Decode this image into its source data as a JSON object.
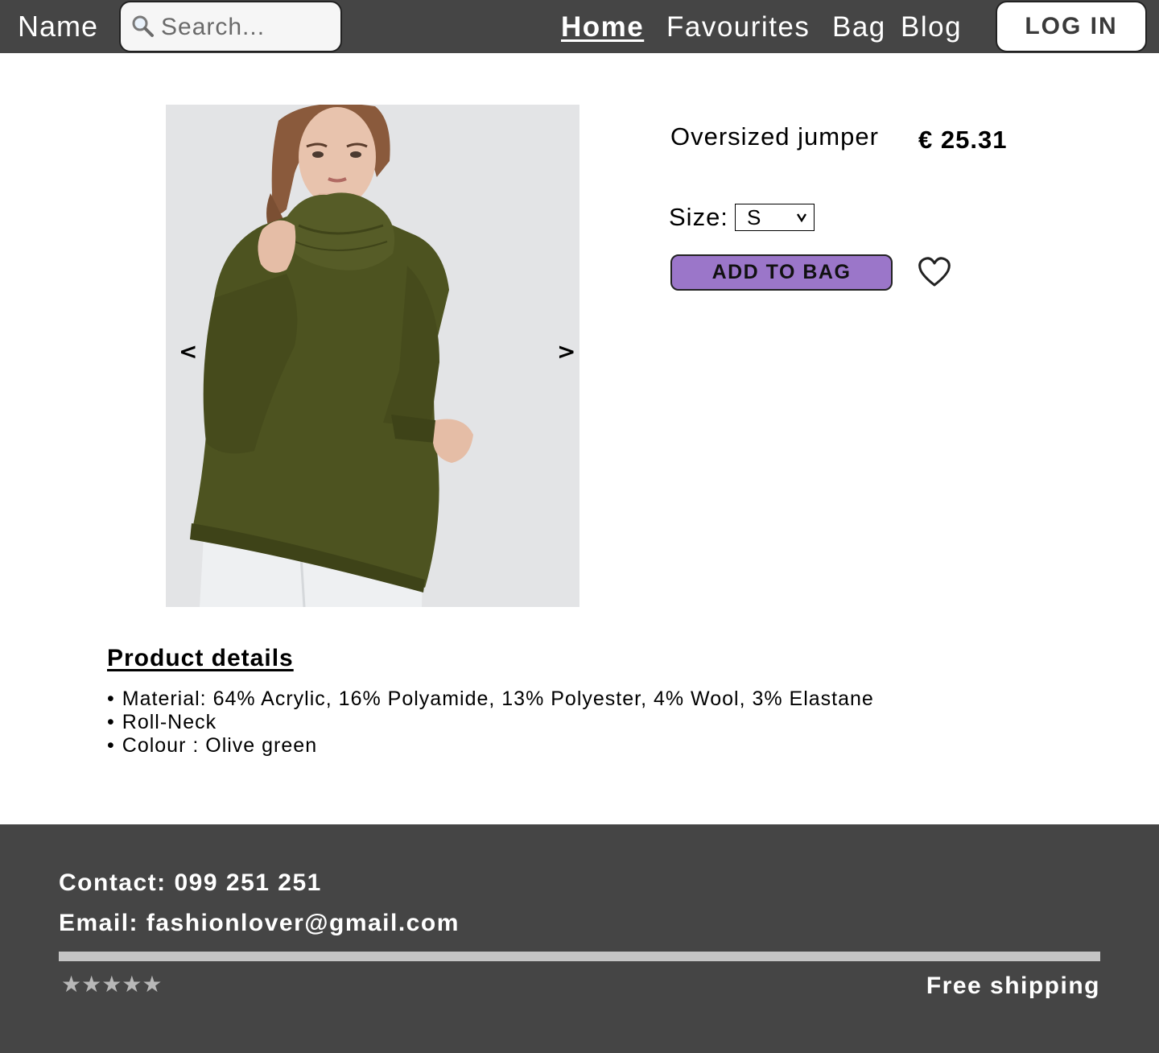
{
  "header": {
    "brand": "Name",
    "search": {
      "placeholder": "Search...",
      "value": ""
    },
    "nav": [
      {
        "label": "Home",
        "active": true
      },
      {
        "label": "Favourites",
        "active": false
      },
      {
        "label": "Bag",
        "active": false
      },
      {
        "label": "Blog",
        "active": false
      }
    ],
    "login_label": "LOG IN"
  },
  "product": {
    "name": "Oversized jumper",
    "price": "€ 25.31",
    "size_label": "Size:",
    "selected_size": "S",
    "add_to_bag_label": "ADD TO BAG",
    "gallery": {
      "prev_label": "<",
      "next_label": ">"
    },
    "accent_color": "#9b76c9",
    "garment_color": "#4d5320"
  },
  "details": {
    "title": "Product details",
    "items": [
      "Material: 64% Acrylic, 16% Polyamide, 13% Polyester, 4% Wool, 3% Elastane",
      "Roll-Neck",
      "Colour : Olive green"
    ]
  },
  "footer": {
    "contact": "Contact: 099 251 251",
    "email": "Email: fashionlover@gmail.com",
    "stars": "★★★★★",
    "shipping": "Free shipping"
  },
  "icons": {
    "search": "search-icon",
    "heart": "heart-icon",
    "chevron": "chevron-down-icon"
  },
  "colors": {
    "header_bg": "#454545",
    "footer_bg": "#454545",
    "divider": "#c5c5c5"
  }
}
